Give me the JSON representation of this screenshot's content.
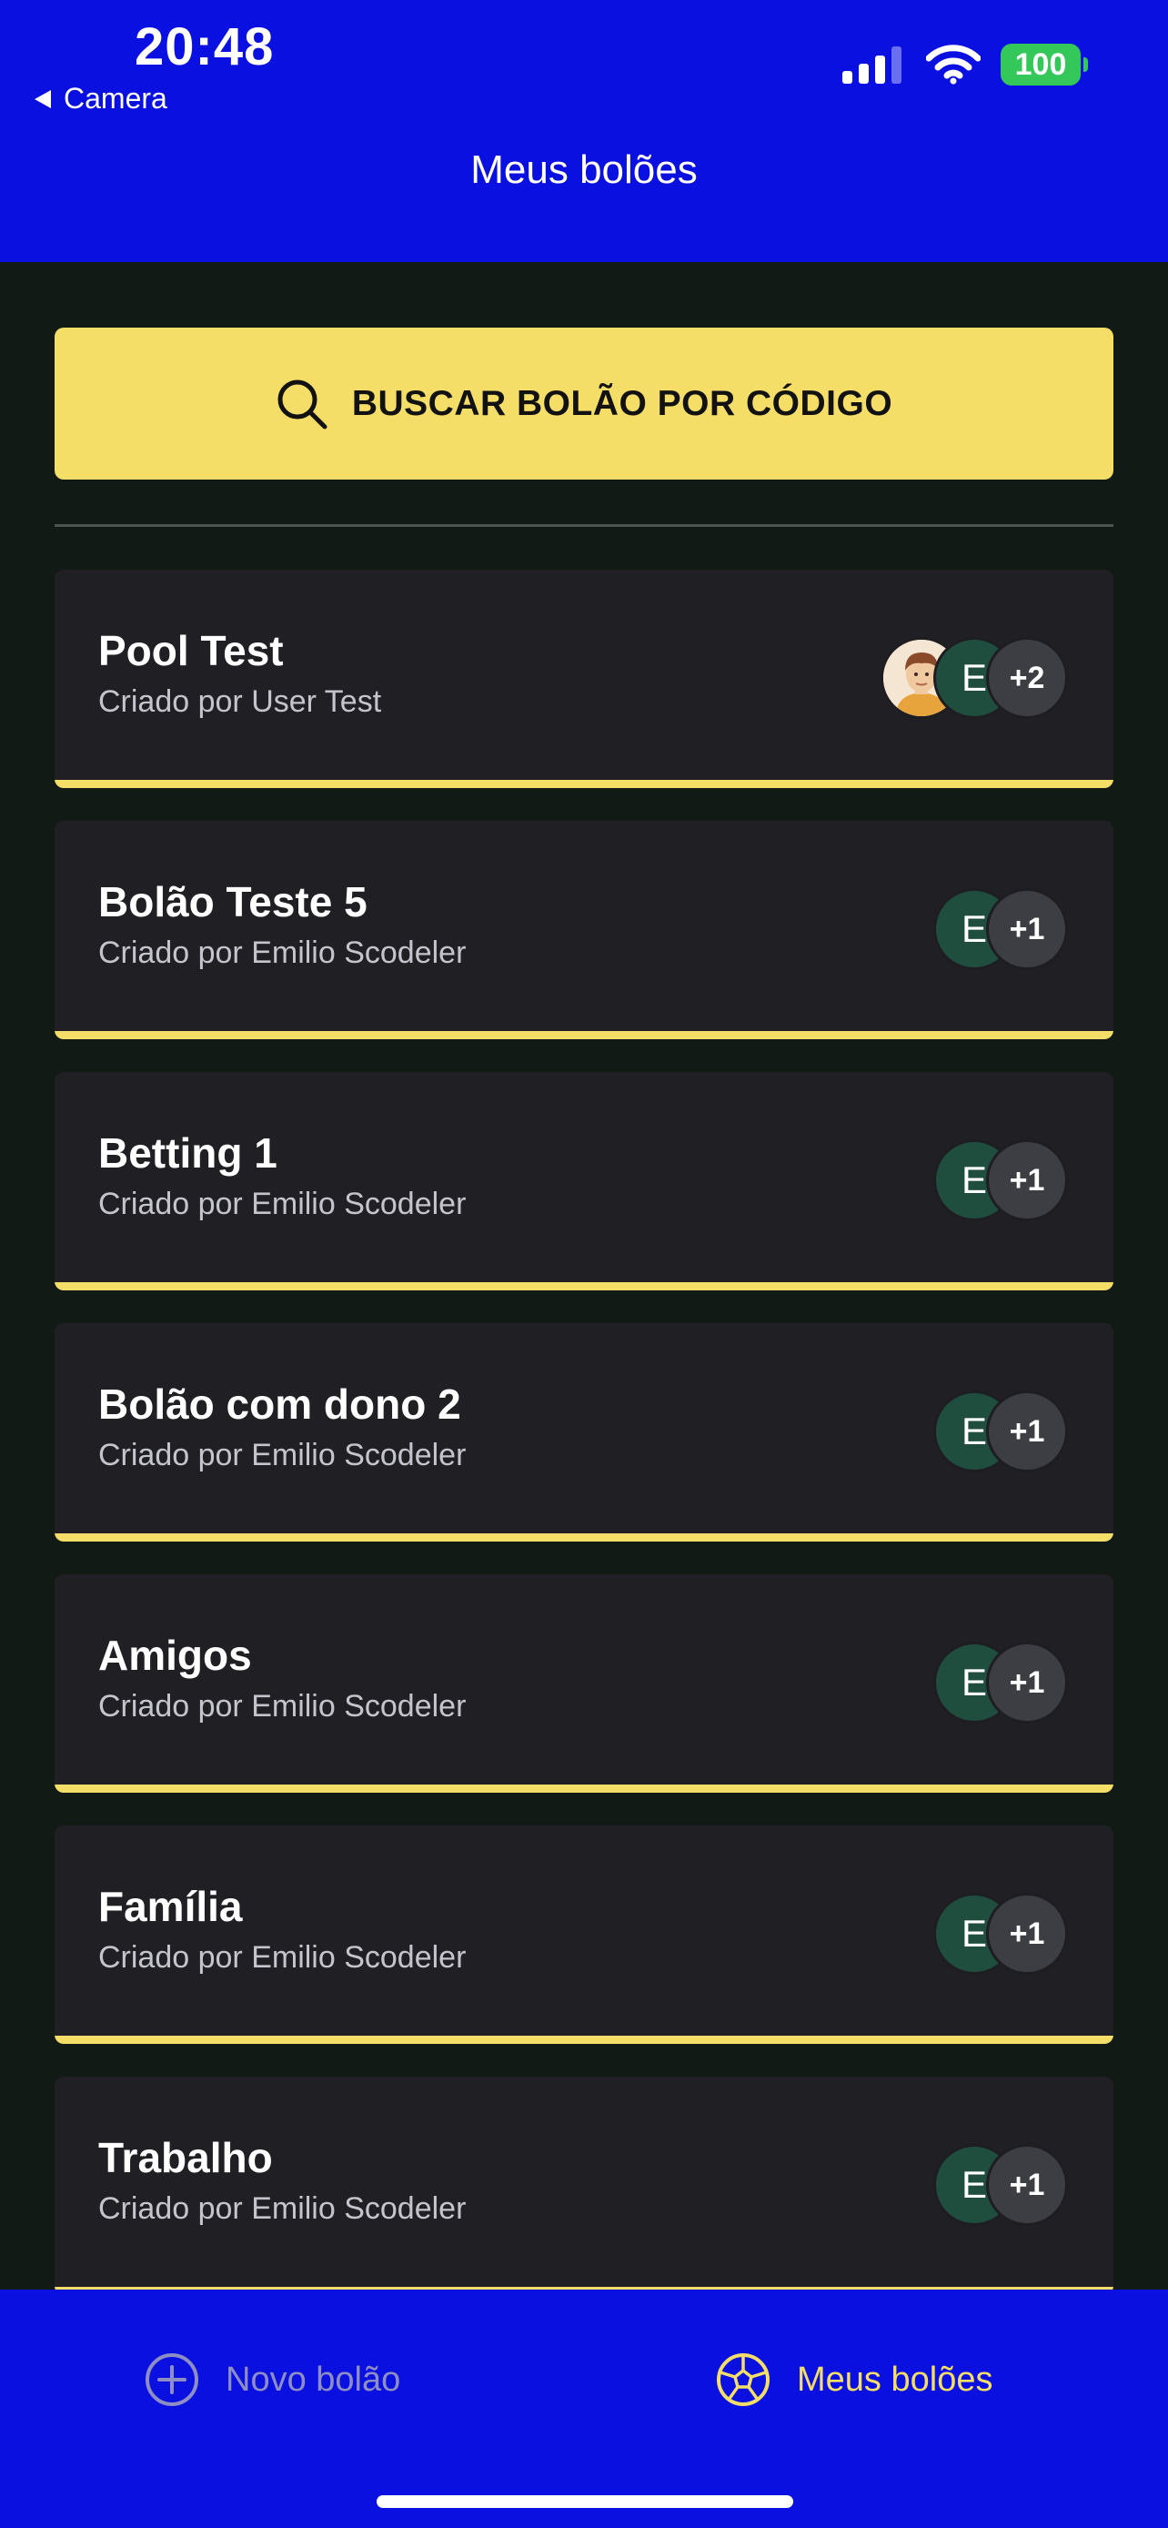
{
  "status_bar": {
    "time": "20:48",
    "back_app": "Camera",
    "battery": "100"
  },
  "header": {
    "title": "Meus bolões"
  },
  "search": {
    "label": "BUSCAR BOLÃO POR CÓDIGO",
    "icon": "search-icon"
  },
  "pools": [
    {
      "title": "Pool Test",
      "owner": "Criado por User Test",
      "avatar_initial": "E",
      "extra_count": "+2",
      "has_photo_avatar": true
    },
    {
      "title": "Bolão Teste 5",
      "owner": "Criado por Emilio Scodeler",
      "avatar_initial": "E",
      "extra_count": "+1"
    },
    {
      "title": "Betting 1",
      "owner": "Criado por Emilio Scodeler",
      "avatar_initial": "E",
      "extra_count": "+1"
    },
    {
      "title": "Bolão com dono 2",
      "owner": "Criado por Emilio Scodeler",
      "avatar_initial": "E",
      "extra_count": "+1"
    },
    {
      "title": "Amigos",
      "owner": "Criado por Emilio Scodeler",
      "avatar_initial": "E",
      "extra_count": "+1"
    },
    {
      "title": "Família",
      "owner": "Criado por Emilio Scodeler",
      "avatar_initial": "E",
      "extra_count": "+1"
    },
    {
      "title": "Trabalho",
      "owner": "Criado por Emilio Scodeler",
      "avatar_initial": "E",
      "extra_count": "+1"
    }
  ],
  "tabs": {
    "new_pool": {
      "label": "Novo bolão",
      "icon": "plus-circle-icon"
    },
    "my_pools": {
      "label": "Meus bolões",
      "icon": "soccer-ball-icon",
      "active": true
    }
  },
  "colors": {
    "header_bg": "#0a10e0",
    "background": "#121a15",
    "accent": "#f4de68",
    "card_bg": "#202024",
    "battery": "#34c759"
  }
}
